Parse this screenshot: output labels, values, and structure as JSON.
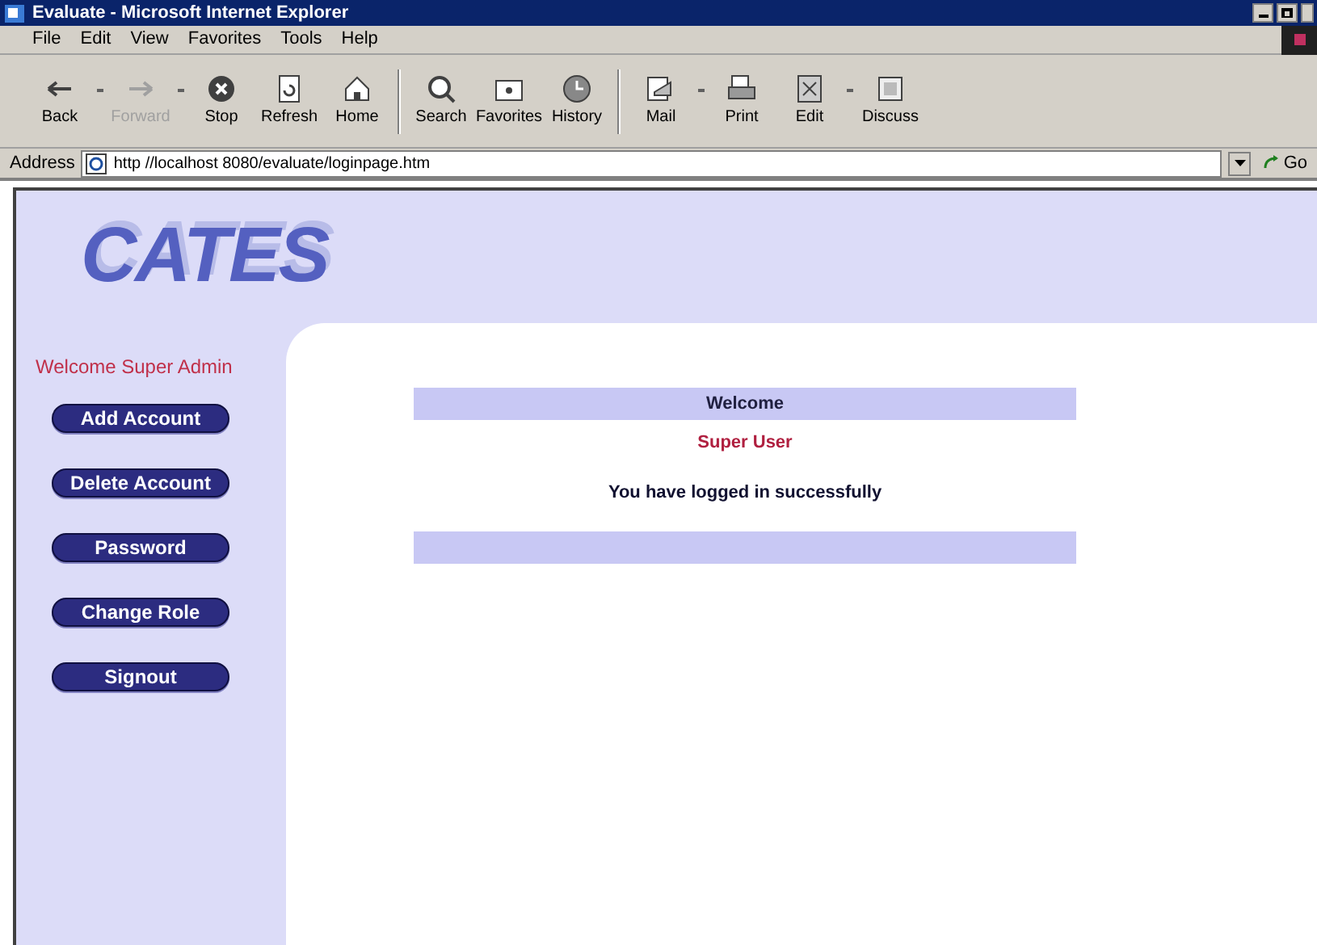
{
  "window": {
    "title": "Evaluate - Microsoft Internet Explorer"
  },
  "menu": [
    "File",
    "Edit",
    "View",
    "Favorites",
    "Tools",
    "Help"
  ],
  "toolbar": [
    {
      "label": "Back",
      "kind": "back",
      "disabled": false,
      "dropdown": true
    },
    {
      "label": "Forward",
      "kind": "forward",
      "disabled": true,
      "dropdown": true
    },
    {
      "label": "Stop",
      "kind": "stop",
      "disabled": false,
      "dropdown": false
    },
    {
      "label": "Refresh",
      "kind": "refresh",
      "disabled": false,
      "dropdown": false
    },
    {
      "label": "Home",
      "kind": "home",
      "disabled": false,
      "dropdown": false,
      "separator_after": true
    },
    {
      "label": "Search",
      "kind": "search",
      "disabled": false,
      "dropdown": false
    },
    {
      "label": "Favorites",
      "kind": "favorites",
      "disabled": false,
      "dropdown": false
    },
    {
      "label": "History",
      "kind": "history",
      "disabled": false,
      "dropdown": false,
      "separator_after": true
    },
    {
      "label": "Mail",
      "kind": "mail",
      "disabled": false,
      "dropdown": true
    },
    {
      "label": "Print",
      "kind": "print",
      "disabled": false,
      "dropdown": false
    },
    {
      "label": "Edit",
      "kind": "edit",
      "disabled": false,
      "dropdown": true
    },
    {
      "label": "Discuss",
      "kind": "discuss",
      "disabled": false,
      "dropdown": false
    }
  ],
  "address": {
    "label": "Address",
    "value": "http //localhost 8080/evaluate/loginpage.htm",
    "go": "Go"
  },
  "page": {
    "logo": "CATES",
    "welcome": "Welcome Super Admin",
    "nav_buttons": [
      "Add Account",
      "Delete Account",
      "Password",
      "Change Role",
      "Signout"
    ],
    "panel": {
      "header": "Welcome",
      "user": "Super User",
      "message": "You have logged in successfully"
    }
  }
}
